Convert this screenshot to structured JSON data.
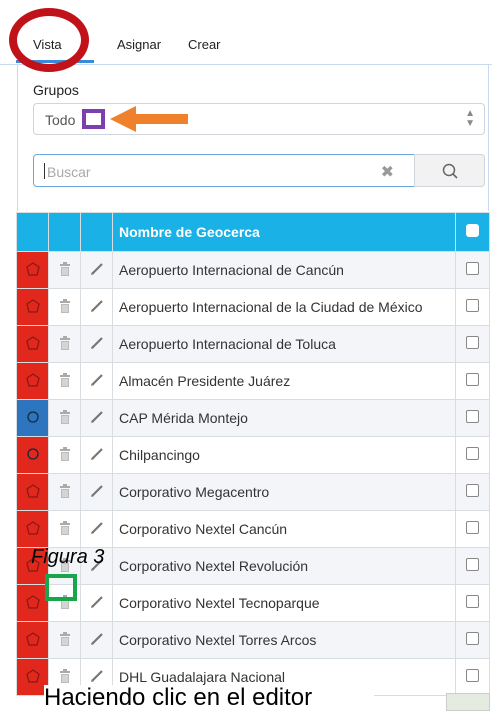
{
  "tabs": [
    {
      "label": "Vista"
    },
    {
      "label": "Asignar"
    },
    {
      "label": "Crear"
    }
  ],
  "groups": {
    "label": "Grupos",
    "value": "Todo"
  },
  "search": {
    "placeholder": "Buscar"
  },
  "table": {
    "header": "Nombre de Geocerca",
    "rows": [
      {
        "name": "Aeropuerto Internacional de Cancún",
        "shape": "polygon",
        "color": "#e2271d"
      },
      {
        "name": "Aeropuerto Internacional de la Ciudad de México",
        "shape": "polygon",
        "color": "#e2271d"
      },
      {
        "name": "Aeropuerto Internacional de Toluca",
        "shape": "polygon",
        "color": "#e2271d"
      },
      {
        "name": "Almacén Presidente Juárez",
        "shape": "polygon",
        "color": "#e2271d"
      },
      {
        "name": "CAP Mérida Montejo",
        "shape": "circle",
        "color": "#2d76bf"
      },
      {
        "name": "Chilpancingo",
        "shape": "circle",
        "color": "#e2271d"
      },
      {
        "name": "Corporativo Megacentro",
        "shape": "polygon",
        "color": "#e2271d"
      },
      {
        "name": "Corporativo Nextel Cancún",
        "shape": "polygon",
        "color": "#e2271d"
      },
      {
        "name": "Corporativo Nextel Revolución",
        "shape": "polygon",
        "color": "#e2271d"
      },
      {
        "name": "Corporativo Nextel Tecnoparque",
        "shape": "polygon",
        "color": "#e2271d"
      },
      {
        "name": "Corporativo Nextel Torres Arcos",
        "shape": "polygon",
        "color": "#e2271d"
      },
      {
        "name": "DHL Guadalajara Nacional",
        "shape": "polygon",
        "color": "#e2271d"
      }
    ]
  },
  "annotations": {
    "figure_label": "Figura 3",
    "caption": "Haciendo clic en el editor"
  }
}
